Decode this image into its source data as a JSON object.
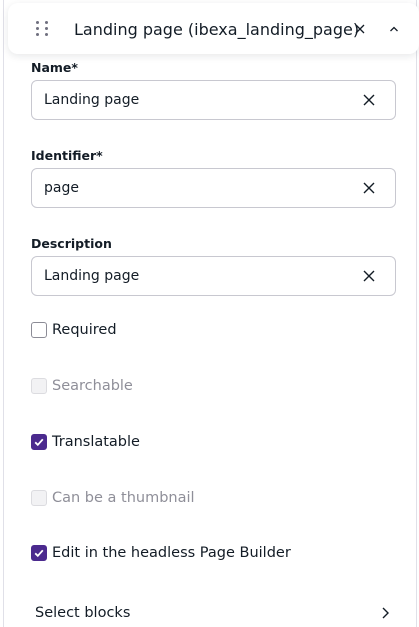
{
  "header": {
    "title": "Landing page (ibexa_landing_page)",
    "drag_icon": "drag-handle-icon",
    "close_icon": "close-icon",
    "collapse_icon": "chevron-up-icon"
  },
  "fields": {
    "name": {
      "label": "Name*",
      "value": "Landing page"
    },
    "identifier": {
      "label": "Identifier*",
      "value": "page"
    },
    "description": {
      "label": "Description",
      "value": "Landing page"
    }
  },
  "checkboxes": [
    {
      "label": "Required",
      "checked": false,
      "disabled": false
    },
    {
      "label": "Searchable",
      "checked": false,
      "disabled": true
    },
    {
      "label": "Translatable",
      "checked": true,
      "disabled": false
    },
    {
      "label": "Can be a thumbnail",
      "checked": false,
      "disabled": true
    },
    {
      "label": "Edit in the headless Page Builder",
      "checked": true,
      "disabled": false
    }
  ],
  "select_blocks": {
    "label": "Select blocks",
    "icon": "chevron-right-icon"
  },
  "colors": {
    "accent": "#4b2a8e",
    "text": "#131c26",
    "disabled_text": "#8f8f99"
  }
}
